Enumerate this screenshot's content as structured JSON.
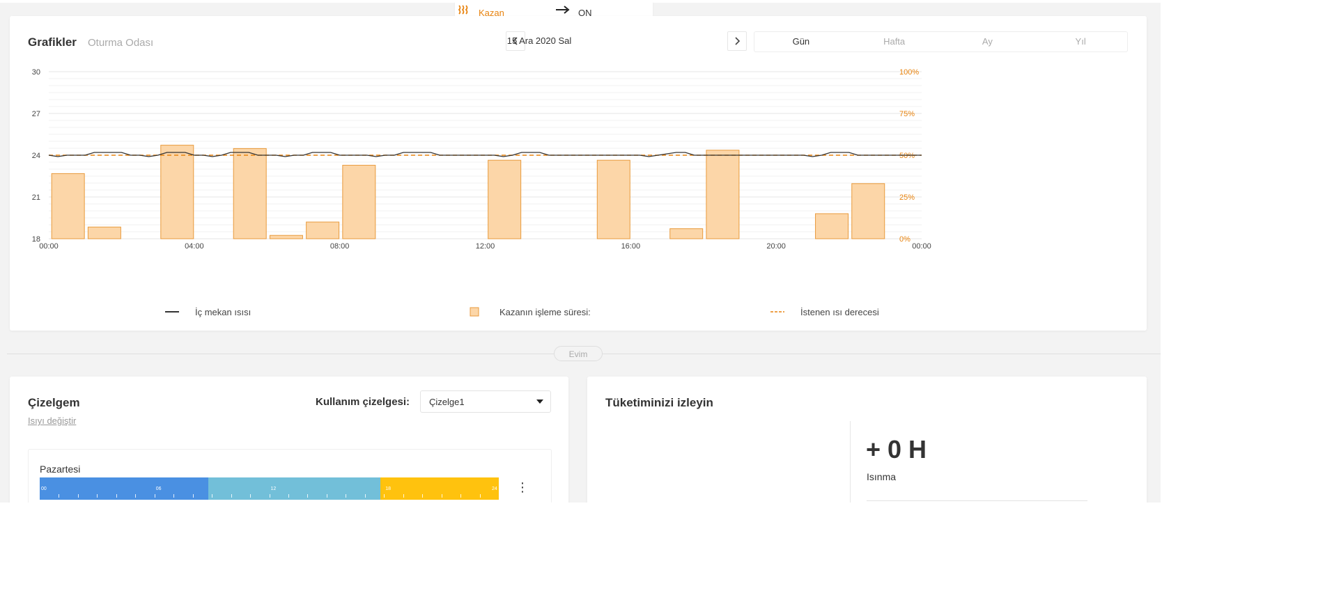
{
  "top_bar": {
    "device_label": "Kazan",
    "device_state": "ON",
    "icon": "radiator-heat-icon",
    "accent": "#e8830e"
  },
  "graphs": {
    "title": "Grafikler",
    "room": "Oturma Odası",
    "date": "15 Ara 2020 Sal",
    "prev_icon": "chevron-left-icon",
    "next_icon": "chevron-right-icon",
    "periods": [
      {
        "label": "Gün",
        "active": true
      },
      {
        "label": "Hafta",
        "active": false
      },
      {
        "label": "Ay",
        "active": false
      },
      {
        "label": "Yıl",
        "active": false
      }
    ]
  },
  "chart_data": {
    "type": "bar",
    "x_tick_labels": [
      "00:00",
      "04:00",
      "08:00",
      "12:00",
      "16:00",
      "20:00",
      "00:00"
    ],
    "y_left": {
      "ticks": [
        "18",
        "21",
        "24",
        "27",
        "30"
      ],
      "range": [
        18,
        30
      ]
    },
    "y_right": {
      "ticks": [
        "0%",
        "25%",
        "50%",
        "75%",
        "100%"
      ],
      "range": [
        0,
        100
      ]
    },
    "grid": true,
    "hours": [
      0,
      1,
      2,
      3,
      4,
      5,
      6,
      7,
      8,
      9,
      10,
      11,
      12,
      13,
      14,
      15,
      16,
      17,
      18,
      19,
      20,
      21,
      22,
      23
    ],
    "series": [
      {
        "name": "Kazanın işleme süresi:",
        "type": "bar",
        "axis": "right",
        "color": "#fcd6a8",
        "edge": "#e89a3c",
        "values": [
          39,
          7,
          0,
          56,
          0,
          54,
          2,
          10,
          44,
          0,
          0,
          0,
          47,
          0,
          0,
          47,
          0,
          6,
          53,
          0,
          0,
          15,
          33,
          0
        ]
      },
      {
        "name": "İç mekan ısısı",
        "type": "line",
        "axis": "left",
        "color": "#333333",
        "x": [
          0,
          0.25,
          0.5,
          0.75,
          1,
          1.25,
          1.5,
          1.75,
          2,
          2.25,
          2.5,
          2.75,
          3,
          3.25,
          3.5,
          3.75,
          4,
          4.25,
          4.5,
          4.75,
          5,
          5.25,
          5.5,
          5.75,
          6,
          6.25,
          6.5,
          6.75,
          7,
          7.25,
          7.5,
          7.75,
          8,
          8.25,
          8.5,
          8.75,
          9,
          9.25,
          9.5,
          9.75,
          10,
          10.25,
          10.5,
          10.75,
          11,
          11.25,
          11.5,
          11.75,
          12,
          12.25,
          12.5,
          12.75,
          13,
          13.25,
          13.5,
          13.75,
          14,
          14.25,
          14.5,
          14.75,
          15,
          15.25,
          15.5,
          15.75,
          16,
          16.25,
          16.5,
          16.75,
          17,
          17.25,
          17.5,
          17.75,
          18,
          18.25,
          18.5,
          18.75,
          19,
          19.25,
          19.5,
          19.75,
          20,
          20.25,
          20.5,
          20.75,
          21,
          21.25,
          21.5,
          21.75,
          22,
          22.25,
          22.5,
          22.75,
          23,
          23.25,
          23.5,
          23.75,
          24
        ],
        "values": [
          24.0,
          23.9,
          24.0,
          24.0,
          24.0,
          24.2,
          24.2,
          24.2,
          24.2,
          24.0,
          24.0,
          23.9,
          24.0,
          24.2,
          24.2,
          24.2,
          24.0,
          24.0,
          23.9,
          24.0,
          24.2,
          24.2,
          24.2,
          24.0,
          24.0,
          24.0,
          23.9,
          24.0,
          24.0,
          24.2,
          24.2,
          24.2,
          24.0,
          24.0,
          24.0,
          24.0,
          23.9,
          24.0,
          24.0,
          24.2,
          24.2,
          24.2,
          24.2,
          24.0,
          24.0,
          24.0,
          24.0,
          24.0,
          24.0,
          24.0,
          23.9,
          24.0,
          24.2,
          24.2,
          24.2,
          24.0,
          24.0,
          24.0,
          24.0,
          24.0,
          24.0,
          24.0,
          24.0,
          24.0,
          24.0,
          24.0,
          23.9,
          24.0,
          24.1,
          24.2,
          24.2,
          24.0,
          24.0,
          24.0,
          24.0,
          24.0,
          24.0,
          24.0,
          24.0,
          24.0,
          24.0,
          24.0,
          24.0,
          24.0,
          23.9,
          24.0,
          24.2,
          24.2,
          24.2,
          24.0,
          24.0,
          24.0,
          24.0,
          24.0,
          24.0,
          24.0,
          24.0
        ]
      },
      {
        "name": "İstenen ısı derecesi",
        "type": "line",
        "axis": "left",
        "style": "dashed",
        "color": "#e8830e",
        "value": 24
      }
    ]
  },
  "divider_label": "Evim",
  "schedule": {
    "title": "Çizelgem",
    "change_link": "Isıyı değiştir",
    "usage_label": "Kullanım çizelgesi:",
    "selected": "Çizelge1",
    "day": "Pazartesi",
    "segments": [
      {
        "from": 0,
        "to": 8.8,
        "color": "#4a90e2"
      },
      {
        "from": 8.8,
        "to": 17.8,
        "color": "#72bfd9"
      },
      {
        "from": 17.8,
        "to": 24,
        "color": "#ffc20e"
      }
    ],
    "bar_labels": [
      "00",
      "06",
      "12",
      "18",
      "24"
    ]
  },
  "consumption": {
    "title": "Tüketiminizi izleyin",
    "value": "+ 0 H",
    "label": "Isınma"
  }
}
